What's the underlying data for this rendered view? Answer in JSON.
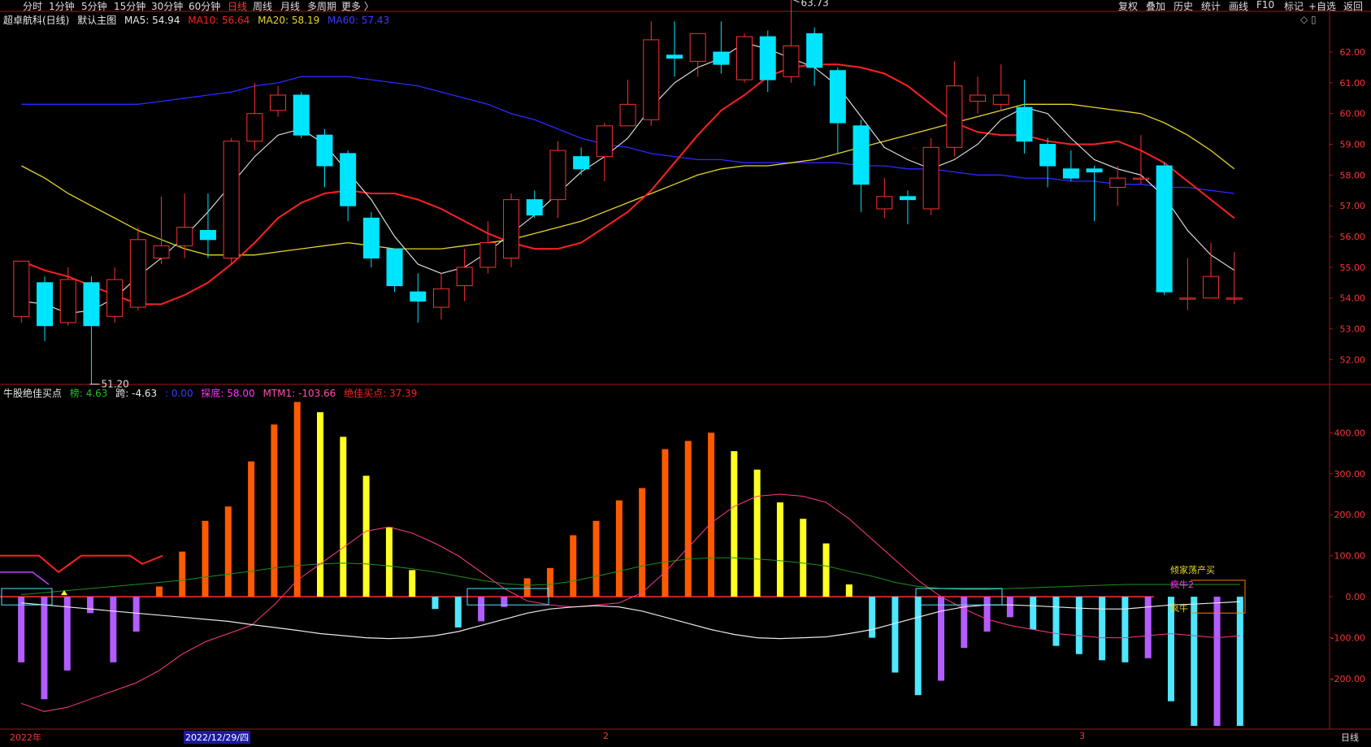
{
  "toolbar": {
    "timeframes": [
      "分时",
      "1分钟",
      "5分钟",
      "15分钟",
      "30分钟",
      "60分钟",
      "日线",
      "周线",
      "月线",
      "多周期",
      "更多 〉"
    ],
    "active_index": 6,
    "right_buttons": [
      "复权",
      "叠加",
      "历史",
      "统计",
      "画线",
      "F10",
      "标记",
      "+自选",
      "返回"
    ]
  },
  "main_legend": {
    "symbol": "超卓航科(日线)",
    "indicator": "默认主图",
    "ma5": "MA5: 54.94",
    "ma10": "MA10: 56.64",
    "ma20": "MA20: 58.19",
    "ma60": "MA60: 57.43",
    "colors": {
      "ma5": "#e8e8e8",
      "ma10": "#ff2020",
      "ma20": "#e6d52a",
      "ma60": "#2a2aff"
    }
  },
  "sub_legend": {
    "name": "牛股绝佳买点",
    "bang": "榜: 4.63",
    "kua": "跨: -4.63",
    "blank": ": 0.00",
    "tandi": "探底: 58.00",
    "mtm": "MTM1: -103.66",
    "jiajia": "绝佳买点: 37.39"
  },
  "side_labels": {
    "right_top_icons": "◇ ▯",
    "bottom_right": "日线"
  },
  "bottom_labels": [
    "2022年",
    "2022/12/29/四",
    "2",
    "3"
  ],
  "signals": [
    "倾家荡产买",
    "疯牛2",
    "疯牛"
  ],
  "chart_data": [
    {
      "type": "candlestick",
      "y_ticks": [
        "62.00",
        "61.00",
        "60.00",
        "59.00",
        "58.00",
        "57.00",
        "56.00",
        "55.00",
        "54.00",
        "53.00",
        "52.00"
      ],
      "annotations": {
        "high": "63.73",
        "low": "51.20"
      },
      "ylim": [
        51.4,
        62.9
      ],
      "candles": [
        [
          53.4,
          55.2,
          53.2,
          54.6
        ],
        [
          54.5,
          53.1,
          52.6,
          54.7
        ],
        [
          53.2,
          54.6,
          53.1,
          55.0
        ],
        [
          54.5,
          53.1,
          51.2,
          54.7
        ],
        [
          53.4,
          54.6,
          53.2,
          55.0
        ],
        [
          53.7,
          55.9,
          53.6,
          56.3
        ],
        [
          55.3,
          55.7,
          55.1,
          57.3
        ],
        [
          55.7,
          56.3,
          55.3,
          57.4
        ],
        [
          56.2,
          55.9,
          55.3,
          57.4
        ],
        [
          55.3,
          59.1,
          55.1,
          59.2
        ],
        [
          59.1,
          60.0,
          58.8,
          61.0
        ],
        [
          60.1,
          60.6,
          59.9,
          60.9
        ],
        [
          60.6,
          59.3,
          59.2,
          60.7
        ],
        [
          59.3,
          58.3,
          57.6,
          59.5
        ],
        [
          58.7,
          57.0,
          56.5,
          58.8
        ],
        [
          56.6,
          55.3,
          55.0,
          56.8
        ],
        [
          55.6,
          54.4,
          54.2,
          55.6
        ],
        [
          54.2,
          53.9,
          53.2,
          54.8
        ],
        [
          53.7,
          54.3,
          53.3,
          54.8
        ],
        [
          54.4,
          55.0,
          53.9,
          55.6
        ],
        [
          55.0,
          55.8,
          54.8,
          56.5
        ],
        [
          55.3,
          57.2,
          55.0,
          57.4
        ],
        [
          57.2,
          56.7,
          56.6,
          57.5
        ],
        [
          57.2,
          58.8,
          56.6,
          59.1
        ],
        [
          58.6,
          58.2,
          58.0,
          58.9
        ],
        [
          58.6,
          59.6,
          57.8,
          59.7
        ],
        [
          59.6,
          60.3,
          59.6,
          61.1
        ],
        [
          59.8,
          62.4,
          59.6,
          63.0
        ],
        [
          61.9,
          61.8,
          61.2,
          63.0
        ],
        [
          61.7,
          62.6,
          61.2,
          62.6
        ],
        [
          62.0,
          61.6,
          61.3,
          63.0
        ],
        [
          61.1,
          62.5,
          61.0,
          62.6
        ],
        [
          62.5,
          61.1,
          60.7,
          62.7
        ],
        [
          61.2,
          62.2,
          61.0,
          63.7
        ],
        [
          62.6,
          61.5,
          60.9,
          62.8
        ],
        [
          61.4,
          59.7,
          58.7,
          61.5
        ],
        [
          59.6,
          57.7,
          56.8,
          59.8
        ],
        [
          56.9,
          57.3,
          56.6,
          57.9
        ],
        [
          57.3,
          57.2,
          56.4,
          57.5
        ],
        [
          56.9,
          58.9,
          56.7,
          59.2
        ],
        [
          58.9,
          60.9,
          58.6,
          61.7
        ],
        [
          60.4,
          60.6,
          60.0,
          61.2
        ],
        [
          60.3,
          60.6,
          60.1,
          61.6
        ],
        [
          60.2,
          59.1,
          58.7,
          61.1
        ],
        [
          59.0,
          58.3,
          57.6,
          59.2
        ],
        [
          58.2,
          57.9,
          57.8,
          58.8
        ],
        [
          58.2,
          58.1,
          56.5,
          58.3
        ],
        [
          57.6,
          57.9,
          57.0,
          58.3
        ],
        [
          57.9,
          57.9,
          57.7,
          59.3
        ],
        [
          58.3,
          54.2,
          54.1,
          58.4
        ],
        [
          54.0,
          54.0,
          53.6,
          55.3
        ],
        [
          54.0,
          54.7,
          54.0,
          55.8
        ],
        [
          54.0,
          54.0,
          53.8,
          55.5
        ]
      ],
      "ma5": [
        53.9,
        53.8,
        53.5,
        53.6,
        54.0,
        54.7,
        55.3,
        56.0,
        56.8,
        57.7,
        58.6,
        59.3,
        59.5,
        59.0,
        58.1,
        57.2,
        56.0,
        55.1,
        54.8,
        55.0,
        55.5,
        56.1,
        56.7,
        57.4,
        58.1,
        58.6,
        59.2,
        60.2,
        61.0,
        61.5,
        61.8,
        62.3,
        62.1,
        61.8,
        61.5,
        60.9,
        59.9,
        58.9,
        58.5,
        58.2,
        58.5,
        59.0,
        59.8,
        60.2,
        60.0,
        59.2,
        58.5,
        58.2,
        58.0,
        57.3,
        56.2,
        55.4,
        54.9
      ],
      "ma10": [
        55.2,
        54.9,
        54.7,
        54.4,
        54.1,
        53.8,
        53.8,
        54.1,
        54.5,
        55.1,
        55.8,
        56.6,
        57.1,
        57.4,
        57.5,
        57.4,
        57.4,
        57.2,
        56.9,
        56.5,
        56.1,
        55.8,
        55.6,
        55.6,
        55.8,
        56.3,
        56.8,
        57.5,
        58.4,
        59.3,
        60.1,
        60.6,
        61.2,
        61.5,
        61.6,
        61.6,
        61.5,
        61.3,
        60.9,
        60.3,
        59.7,
        59.4,
        59.3,
        59.3,
        59.1,
        59.0,
        59.0,
        59.1,
        58.8,
        58.4,
        57.8,
        57.2,
        56.6
      ],
      "ma20": [
        58.3,
        57.9,
        57.4,
        57.0,
        56.6,
        56.2,
        55.9,
        55.6,
        55.4,
        55.4,
        55.4,
        55.5,
        55.6,
        55.7,
        55.8,
        55.7,
        55.6,
        55.6,
        55.6,
        55.7,
        55.8,
        55.9,
        56.1,
        56.3,
        56.5,
        56.8,
        57.1,
        57.4,
        57.7,
        58.0,
        58.2,
        58.3,
        58.3,
        58.4,
        58.5,
        58.7,
        58.9,
        59.1,
        59.3,
        59.5,
        59.7,
        59.9,
        60.1,
        60.3,
        60.3,
        60.3,
        60.2,
        60.1,
        60.0,
        59.7,
        59.3,
        58.8,
        58.2
      ],
      "ma60": [
        60.3,
        60.3,
        60.3,
        60.3,
        60.3,
        60.3,
        60.4,
        60.5,
        60.6,
        60.7,
        60.9,
        61.0,
        61.2,
        61.2,
        61.2,
        61.1,
        61.0,
        60.9,
        60.7,
        60.5,
        60.3,
        60.0,
        59.8,
        59.5,
        59.2,
        59.0,
        58.9,
        58.7,
        58.6,
        58.5,
        58.5,
        58.4,
        58.4,
        58.4,
        58.4,
        58.4,
        58.3,
        58.3,
        58.2,
        58.2,
        58.1,
        58.0,
        58.0,
        57.9,
        57.9,
        57.8,
        57.8,
        57.7,
        57.7,
        57.6,
        57.6,
        57.5,
        57.4
      ]
    },
    {
      "type": "bar",
      "y_ticks": [
        "400.00",
        "300.00",
        "200.00",
        "100.00",
        "0.00",
        "-100.00",
        "-200.00"
      ],
      "ylim": [
        -315,
        480
      ],
      "values": [
        -160,
        -250,
        -180,
        -40,
        -160,
        -85,
        25,
        110,
        185,
        220,
        330,
        420,
        475,
        450,
        390,
        295,
        170,
        65,
        -30,
        -75,
        -60,
        -25,
        45,
        70,
        150,
        185,
        235,
        265,
        360,
        380,
        400,
        355,
        310,
        230,
        190,
        130,
        30,
        -100,
        -185,
        -240,
        -205,
        -125,
        -85,
        -50,
        -80,
        -120,
        -140,
        -155,
        -160,
        -150,
        -255,
        -315,
        -315,
        -315
      ],
      "colors": [
        "p",
        "p",
        "p",
        "p",
        "p",
        "p",
        "o",
        "o",
        "o",
        "o",
        "o",
        "o",
        "o",
        "y",
        "y",
        "y",
        "y",
        "y",
        "c",
        "c",
        "p",
        "p",
        "o",
        "o",
        "o",
        "o",
        "o",
        "o",
        "o",
        "o",
        "o",
        "y",
        "y",
        "y",
        "y",
        "y",
        "y",
        "c",
        "c",
        "c",
        "p",
        "p",
        "p",
        "p",
        "c",
        "c",
        "c",
        "c",
        "c",
        "p",
        "c",
        "c",
        "p",
        "c"
      ],
      "mtm_white": [
        -15,
        -20,
        -25,
        -30,
        -35,
        -40,
        -45,
        -50,
        -55,
        -60,
        -68,
        -75,
        -82,
        -90,
        -95,
        -100,
        -102,
        -100,
        -95,
        -85,
        -70,
        -55,
        -40,
        -30,
        -25,
        -22,
        -25,
        -35,
        -50,
        -65,
        -80,
        -92,
        -100,
        -102,
        -100,
        -98,
        -90,
        -80,
        -65,
        -50,
        -35,
        -25,
        -20,
        -20,
        -22,
        -25,
        -28,
        -30,
        -30,
        -25,
        -20,
        -18,
        -15,
        -12
      ],
      "pink_line": [
        -260,
        -280,
        -270,
        -250,
        -230,
        -210,
        -180,
        -140,
        -110,
        -90,
        -70,
        -20,
        40,
        80,
        120,
        160,
        170,
        155,
        130,
        100,
        60,
        20,
        -10,
        -20,
        -25,
        -20,
        -15,
        10,
        60,
        120,
        180,
        220,
        245,
        250,
        245,
        230,
        190,
        140,
        90,
        40,
        0,
        -30,
        -55,
        -70,
        -80,
        -90,
        -95,
        -100,
        -100,
        -95,
        -90,
        -95,
        -100,
        -95
      ],
      "green_line": [
        5,
        10,
        15,
        20,
        25,
        30,
        35,
        40,
        48,
        55,
        62,
        70,
        76,
        80,
        82,
        80,
        75,
        68,
        60,
        50,
        40,
        32,
        28,
        30,
        38,
        50,
        62,
        75,
        85,
        92,
        95,
        95,
        92,
        88,
        82,
        75,
        62,
        50,
        35,
        25,
        20,
        18,
        18,
        20,
        22,
        24,
        26,
        28,
        30,
        30,
        30,
        30,
        30,
        30
      ]
    }
  ]
}
